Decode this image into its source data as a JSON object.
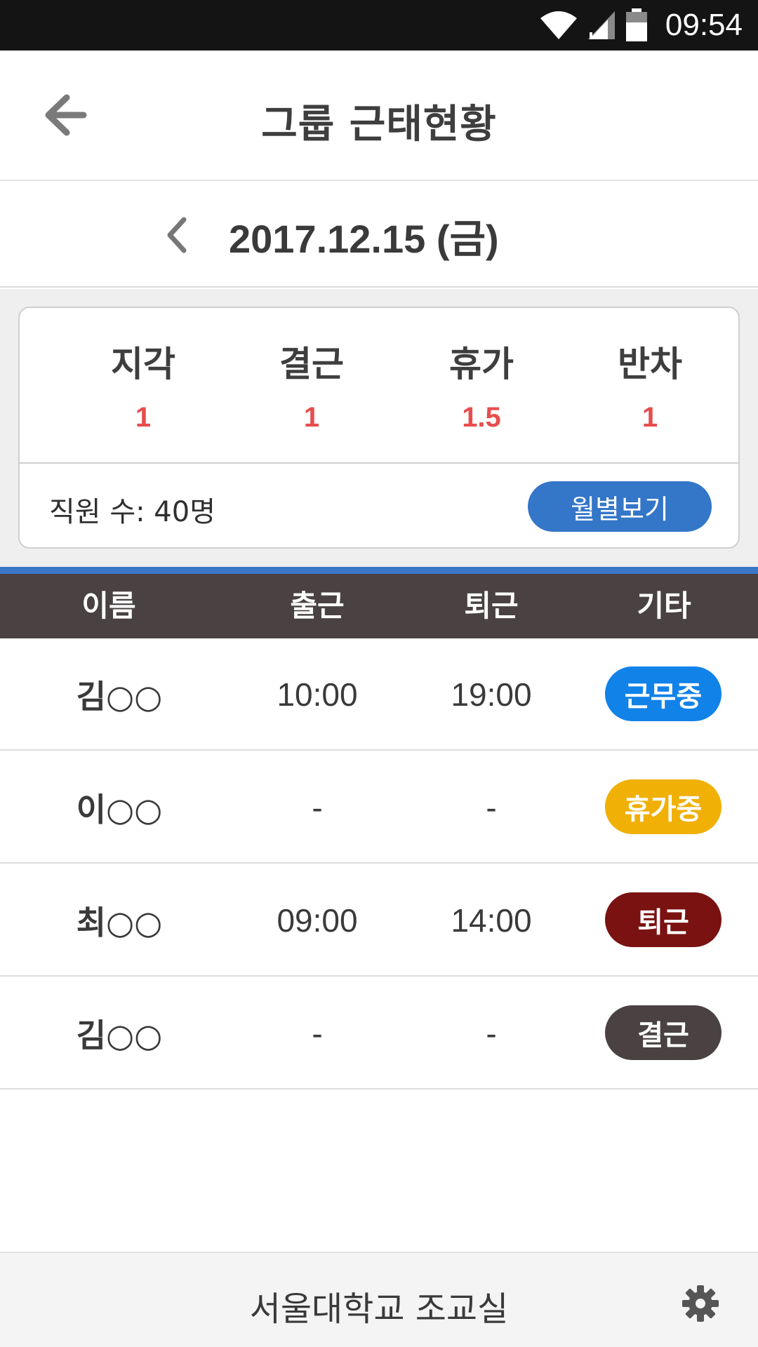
{
  "status_bar": {
    "time": "09:54",
    "icons": [
      "wifi-icon",
      "signal-icon",
      "battery-icon"
    ]
  },
  "header": {
    "title": "그룹 근태현황",
    "back_icon": "arrow-left-icon"
  },
  "date_nav": {
    "date": "2017.12.15 (금)",
    "prev_icon": "chevron-left-icon"
  },
  "summary": {
    "stats": [
      {
        "label": "지각",
        "value": "1"
      },
      {
        "label": "결근",
        "value": "1"
      },
      {
        "label": "휴가",
        "value": "1.5"
      },
      {
        "label": "반차",
        "value": "1"
      }
    ],
    "employee_count": "직원 수: 40명",
    "monthly_button": "월별보기"
  },
  "table": {
    "columns": [
      "이름",
      "출근",
      "퇴근",
      "기타"
    ],
    "rows": [
      {
        "name": "김○○",
        "in": "10:00",
        "out": "19:00",
        "status": "근무중",
        "status_color": "#1182e8"
      },
      {
        "name": "이○○",
        "in": "-",
        "out": "-",
        "status": "휴가중",
        "status_color": "#f0b006"
      },
      {
        "name": "최○○",
        "in": "09:00",
        "out": "14:00",
        "status": "퇴근",
        "status_color": "#7a1212"
      },
      {
        "name": "김○○",
        "in": "-",
        "out": "-",
        "status": "결근",
        "status_color": "#4a4242"
      }
    ]
  },
  "footer": {
    "title": "서울대학교 조교실",
    "settings_icon": "gear-icon"
  },
  "colors": {
    "accent": "#3b78c9",
    "stat_value": "#e84d4d",
    "table_header": "#4a4242"
  }
}
